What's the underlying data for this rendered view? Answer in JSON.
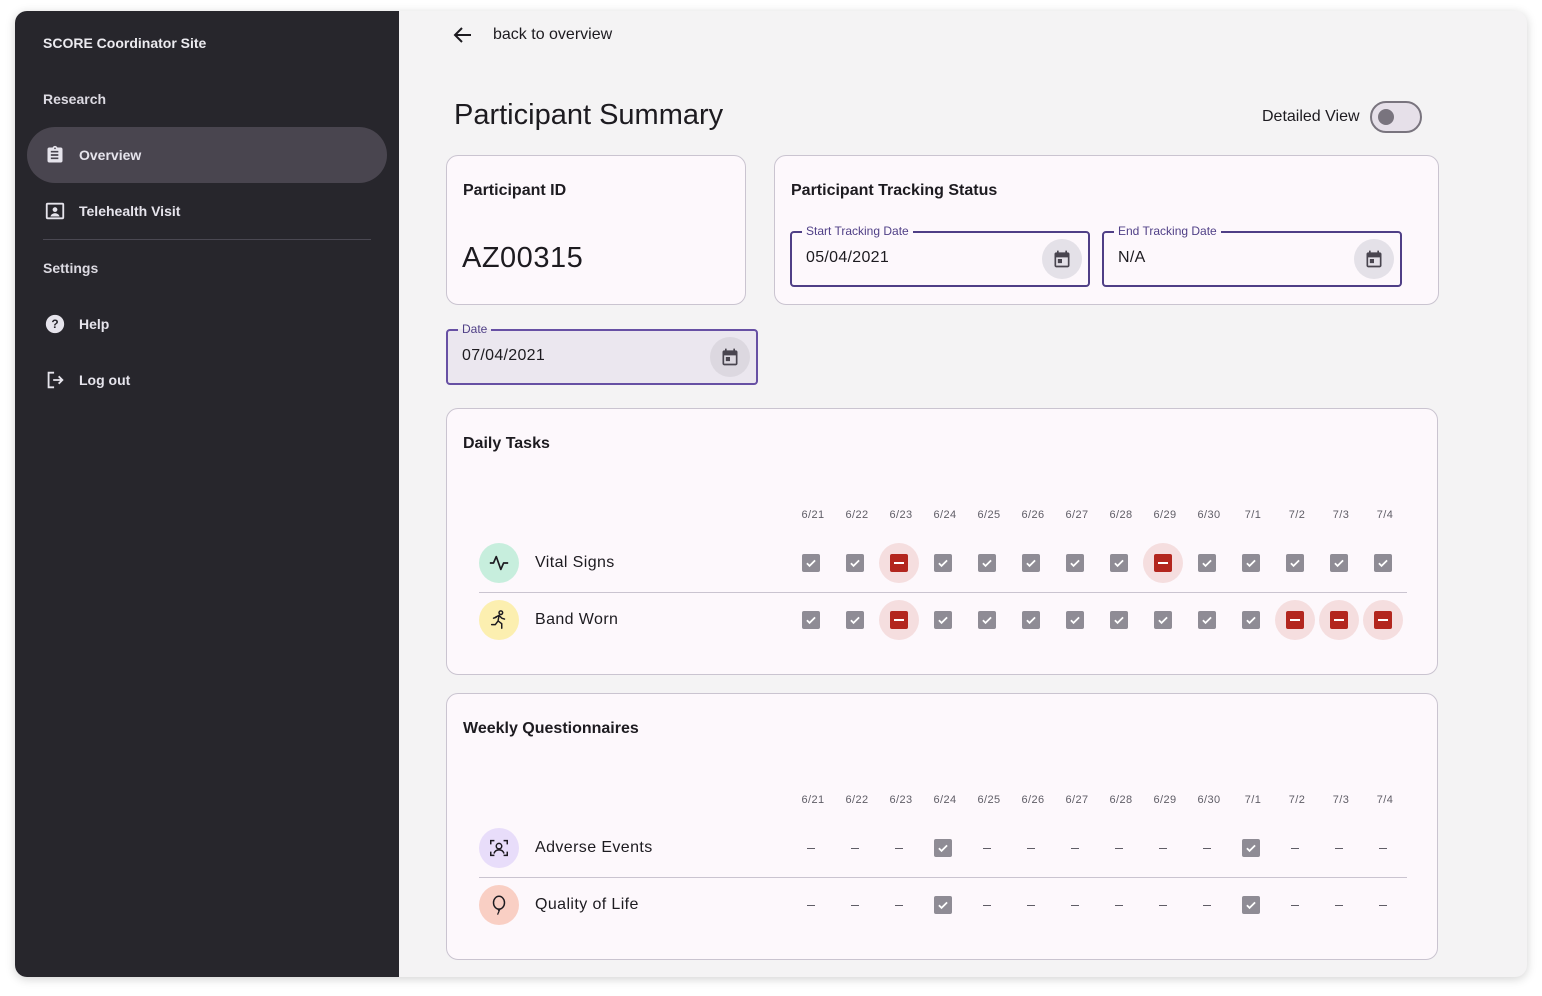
{
  "sidebar": {
    "site_title": "SCORE Coordinator Site",
    "research_label": "Research",
    "items": [
      {
        "label": "Overview",
        "icon": "clipboard-icon",
        "active": true
      },
      {
        "label": "Telehealth Visit",
        "icon": "video-person-icon",
        "active": false
      }
    ],
    "settings_label": "Settings",
    "settings_items": [
      {
        "label": "Help",
        "icon": "help-circle-icon"
      },
      {
        "label": "Log out",
        "icon": "logout-icon"
      }
    ]
  },
  "header": {
    "back_label": "back to overview",
    "title": "Participant Summary",
    "detailed_view_label": "Detailed View",
    "detailed_view_on": false
  },
  "participant": {
    "id_title": "Participant ID",
    "id_value": "AZ00315"
  },
  "tracking": {
    "title": "Participant Tracking Status",
    "start_label": "Start Tracking Date",
    "start_value": "05/04/2021",
    "end_label": "End Tracking Date",
    "end_value": "N/A"
  },
  "date_filter": {
    "label": "Date",
    "value": "07/04/2021"
  },
  "dates": [
    "6/21",
    "6/22",
    "6/23",
    "6/24",
    "6/25",
    "6/26",
    "6/27",
    "6/28",
    "6/29",
    "6/30",
    "7/1",
    "7/2",
    "7/3",
    "7/4"
  ],
  "daily_tasks": {
    "title": "Daily Tasks",
    "rows": [
      {
        "label": "Vital Signs",
        "icon": "pulse-icon",
        "icon_bg": "#c7eedd",
        "status": [
          "done",
          "done",
          "missed",
          "done",
          "done",
          "done",
          "done",
          "done",
          "missed",
          "done",
          "done",
          "done",
          "done",
          "done"
        ]
      },
      {
        "label": "Band Worn",
        "icon": "running-person-icon",
        "icon_bg": "#fcefb0",
        "status": [
          "done",
          "done",
          "missed",
          "done",
          "done",
          "done",
          "done",
          "done",
          "done",
          "done",
          "done",
          "missed",
          "missed",
          "missed"
        ]
      }
    ]
  },
  "weekly": {
    "title": "Weekly Questionnaires",
    "rows": [
      {
        "label": "Adverse Events",
        "icon": "person-scan-icon",
        "icon_bg": "#e8ddfa",
        "status": [
          "none",
          "none",
          "none",
          "done",
          "none",
          "none",
          "none",
          "none",
          "none",
          "none",
          "done",
          "none",
          "none",
          "none"
        ]
      },
      {
        "label": "Quality of Life",
        "icon": "balloon-icon",
        "icon_bg": "#f9cfc4",
        "status": [
          "none",
          "none",
          "none",
          "done",
          "none",
          "none",
          "none",
          "none",
          "none",
          "none",
          "done",
          "none",
          "none",
          "none"
        ]
      }
    ]
  },
  "colors": {
    "sidebar_bg": "#27262c",
    "active_nav_bg": "#49454f",
    "accent": "#4f3f86",
    "missed": "#b3261e",
    "missed_bg": "#f5dedf",
    "done": "#8f8c95"
  }
}
